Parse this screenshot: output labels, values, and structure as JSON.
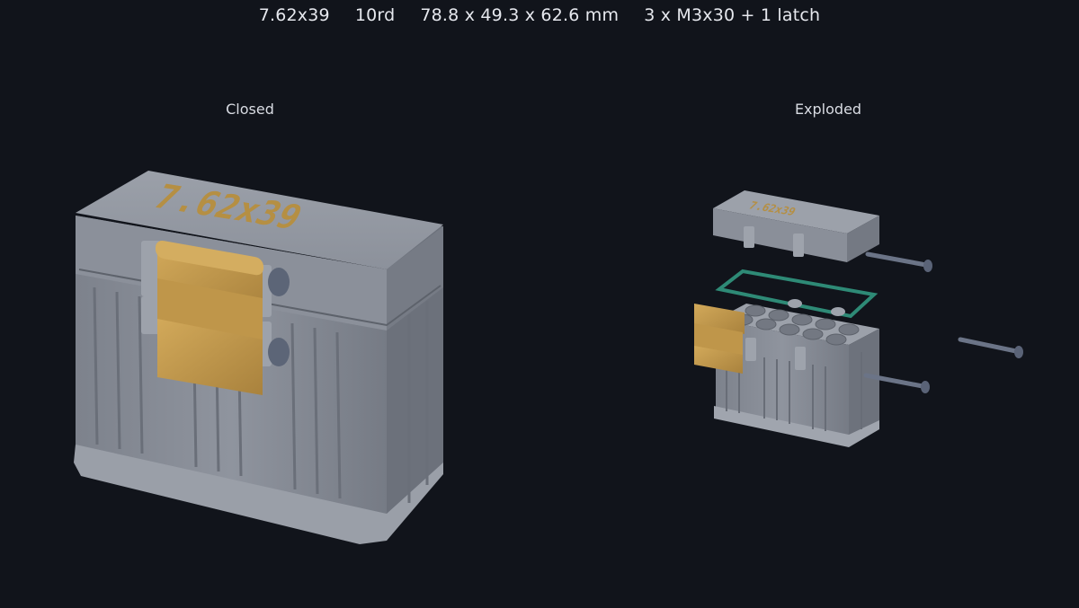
{
  "header": {
    "caliber": "7.62x39",
    "rounds": "10rd",
    "dimensions": "78.8 x 49.3 x 62.6 mm",
    "hardware": "3 x M3x30 + 1 latch"
  },
  "views": {
    "closed_label": "Closed",
    "exploded_label": "Exploded"
  },
  "model": {
    "lid_engraving": "7.62x39",
    "body_color": "#8a8f99",
    "latch_color": "#c49a4c",
    "gasket_color": "#2e8a76",
    "screw_color": "#6b7487"
  }
}
